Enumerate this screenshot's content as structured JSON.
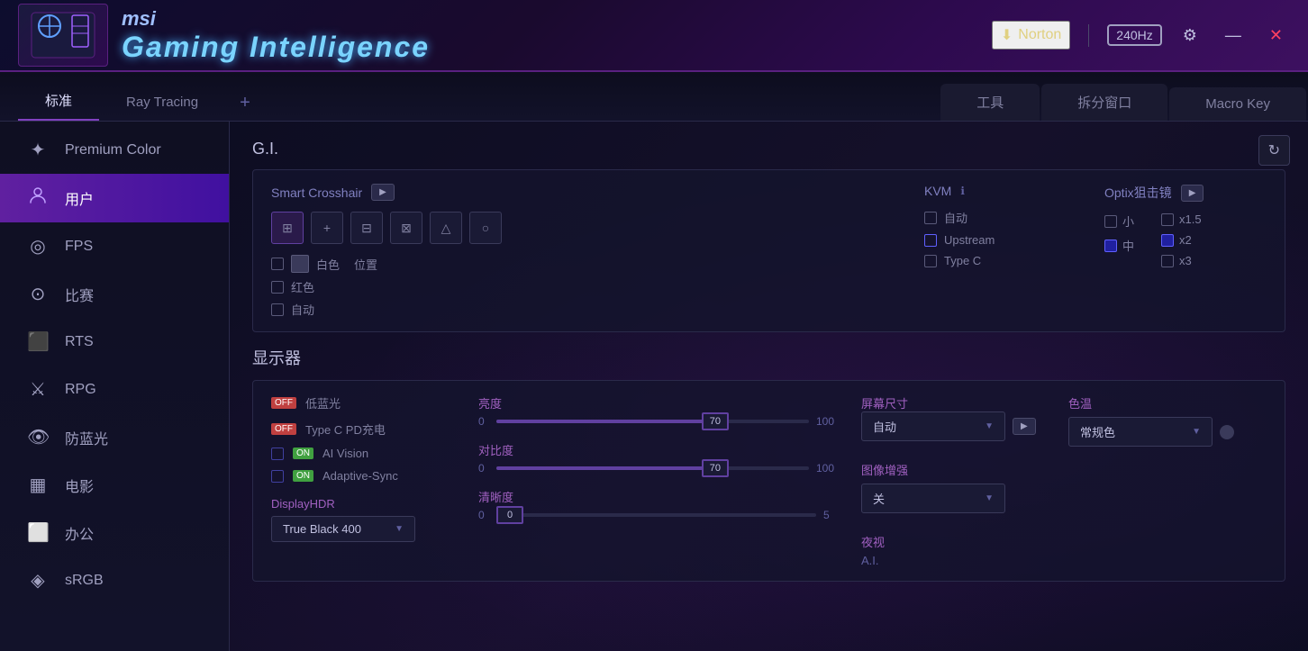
{
  "titlebar": {
    "msi_text": "msi",
    "gi_text": "Gaming Intelligence",
    "norton_label": "Norton",
    "hz_label": "240Hz",
    "minimize_label": "—",
    "close_label": "✕"
  },
  "tabs_left": {
    "items": [
      {
        "id": "standard",
        "label": "标准",
        "active": true
      },
      {
        "id": "raytracing",
        "label": "Ray Tracing",
        "active": false
      },
      {
        "id": "add",
        "label": "+",
        "active": false
      }
    ]
  },
  "tabs_right": {
    "items": [
      {
        "id": "tools",
        "label": "工具",
        "active": false
      },
      {
        "id": "splitwindow",
        "label": "拆分窗口",
        "active": false
      },
      {
        "id": "macrokey",
        "label": "Macro Key",
        "active": false
      }
    ]
  },
  "sidebar": {
    "items": [
      {
        "id": "premium",
        "label": "Premium Color",
        "icon": "⚙"
      },
      {
        "id": "user",
        "label": "用户",
        "icon": "👤",
        "active": true
      },
      {
        "id": "fps",
        "label": "FPS",
        "icon": "◎"
      },
      {
        "id": "race",
        "label": "比赛",
        "icon": "⊙"
      },
      {
        "id": "rts",
        "label": "RTS",
        "icon": "♟"
      },
      {
        "id": "rpg",
        "label": "RPG",
        "icon": "⚔"
      },
      {
        "id": "bluelight",
        "label": "防蓝光",
        "icon": "👁"
      },
      {
        "id": "movie",
        "label": "电影",
        "icon": "🎬"
      },
      {
        "id": "office",
        "label": "办公",
        "icon": "💼"
      },
      {
        "id": "srgb",
        "label": "sRGB",
        "icon": "🌐"
      }
    ]
  },
  "gi_section": {
    "title": "G.I.",
    "smart_crosshair": {
      "label": "Smart Crosshair",
      "play_btn": "▶"
    },
    "crosshair_icons": [
      "⊞",
      "+",
      "⊟",
      "⊠",
      "△",
      "○"
    ],
    "color_options": [
      {
        "label": "白色"
      },
      {
        "label": "红色"
      },
      {
        "label": "自动"
      }
    ],
    "position_btn": "位置",
    "kvm": {
      "label": "KVM",
      "options": [
        {
          "label": "自动"
        },
        {
          "label": "Upstream"
        },
        {
          "label": "Type C"
        }
      ]
    },
    "optix": {
      "label": "Optix狙击镜",
      "play_btn": "▶",
      "size_options": [
        {
          "label": "小"
        },
        {
          "label": "中",
          "checked": true
        }
      ],
      "zoom_options": [
        {
          "label": "x1.5"
        },
        {
          "label": "x2",
          "checked": true
        },
        {
          "label": "x3"
        }
      ]
    }
  },
  "display_section": {
    "title": "显示器",
    "toggles": [
      {
        "label": "低蓝光",
        "state": "OFF"
      },
      {
        "label": "Type C PD充电",
        "state": "OFF"
      },
      {
        "label": "AI Vision",
        "state": "ON"
      },
      {
        "label": "Adaptive-Sync",
        "state": "ON"
      }
    ],
    "displayhdr_label": "DisplayHDR",
    "displayhdr_value": "True Black 400",
    "sliders": [
      {
        "label": "亮度",
        "min": "0",
        "max": "100",
        "value": "70",
        "percent": 70
      },
      {
        "label": "对比度",
        "min": "0",
        "max": "100",
        "value": "70",
        "percent": 70
      },
      {
        "label": "清晰度",
        "min": "0",
        "max": "5",
        "value": "0",
        "percent": 0
      }
    ],
    "screen_size": {
      "label": "屏幕尺寸",
      "value": "自动",
      "play_btn": "▶"
    },
    "image_enhance": {
      "label": "图像增强",
      "value": "关"
    },
    "night_vision": {
      "label": "夜视",
      "value": "A.I."
    },
    "color_temp": {
      "label": "色温",
      "value": "常规色"
    },
    "refresh_btn": "↻"
  }
}
